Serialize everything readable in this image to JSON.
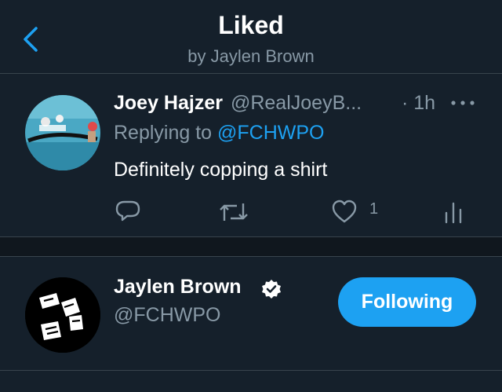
{
  "header": {
    "title": "Liked",
    "subtitle": "by Jaylen Brown",
    "back_icon": "chevron-left-icon"
  },
  "tweet": {
    "author_name": "Joey Hajzer",
    "author_handle": "@RealJoeyB...",
    "time": "· 1h",
    "replying_prefix": "Replying to",
    "replying_mention": "@FCHWPO",
    "text": "Definitely copping a shirt",
    "like_count": "1",
    "icons": [
      "reply-icon",
      "retweet-icon",
      "like-icon",
      "analytics-icon",
      "more-icon"
    ]
  },
  "user": {
    "name": "Jaylen Brown",
    "handle": "@FCHWPO",
    "verified": true,
    "follow_label": "Following"
  },
  "colors": {
    "background": "#15202b",
    "accent": "#1da1f2",
    "secondary_text": "#8899a6",
    "divider": "#38444d"
  }
}
